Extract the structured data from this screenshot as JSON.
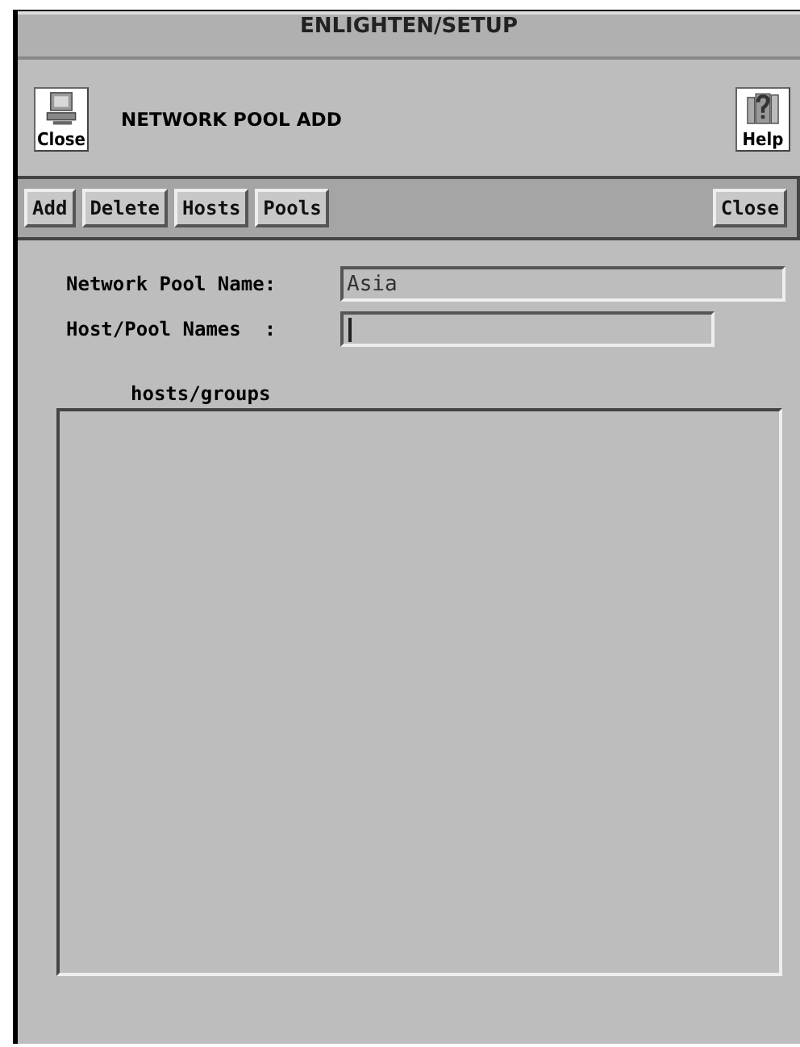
{
  "window": {
    "title": "ENLIGHTEN/SETUP"
  },
  "header": {
    "close_button": "Close",
    "title": "NETWORK POOL ADD",
    "help_button": "Help"
  },
  "toolbar": {
    "left": [
      "Add",
      "Delete",
      "Hosts",
      "Pools"
    ],
    "right": [
      "Close"
    ]
  },
  "fields": [
    {
      "label": "Network Pool Name:",
      "value": "Asia",
      "focused": false
    },
    {
      "label": "Host/Pool Names  :",
      "focused": true
    }
  ],
  "list": {
    "label": "hosts/groups"
  }
}
